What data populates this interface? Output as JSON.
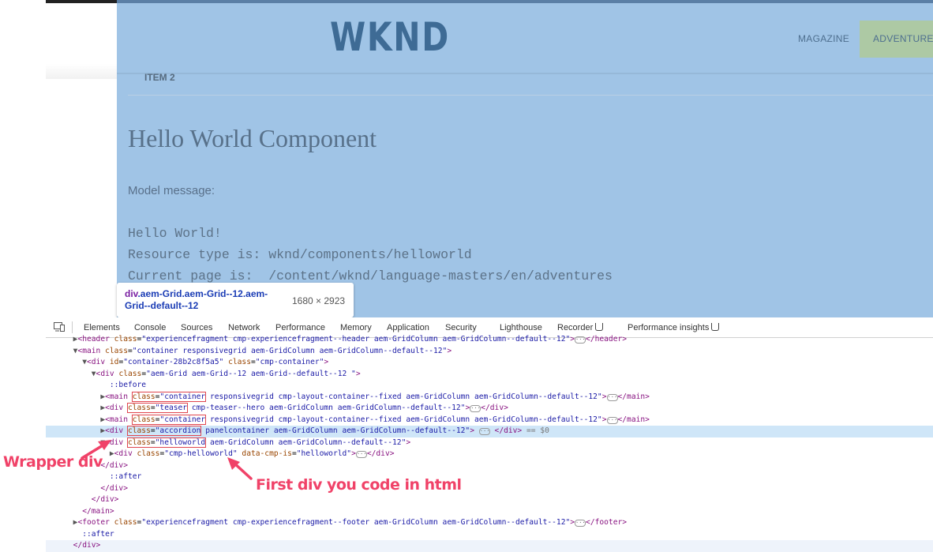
{
  "site": {
    "logo": "WKND",
    "nav": [
      "MAGAZINE",
      "ADVENTURES"
    ],
    "item_label": "ITEM 2",
    "component_title": "Hello World Component",
    "model_message_label": "Model message:",
    "code_lines": [
      "Hello World!",
      "Resource type is: wknd/components/helloworld",
      "Current page is:  /content/wknd/language-masters/en/adventures"
    ]
  },
  "tooltip": {
    "tag": "div",
    "selector": ".aem-Grid.aem-Grid--12.aem-Grid--default--12",
    "size": "1680 × 2923"
  },
  "devtools": {
    "tabs": [
      "Elements",
      "Console",
      "Sources",
      "Network",
      "Performance",
      "Memory",
      "Application",
      "Security",
      "Lighthouse",
      "Recorder",
      "Performance insights"
    ],
    "active_tab": "Elements",
    "selected_suffix": " == $0"
  },
  "annotations": {
    "wrapper": "Wrapper div",
    "first": "First div you code in html"
  },
  "colors": {
    "highlight": "#a0c4e6",
    "annotation": "#f04268",
    "tag": "#881280",
    "attr_name": "#994500",
    "attr_value": "#1a1aa6"
  }
}
